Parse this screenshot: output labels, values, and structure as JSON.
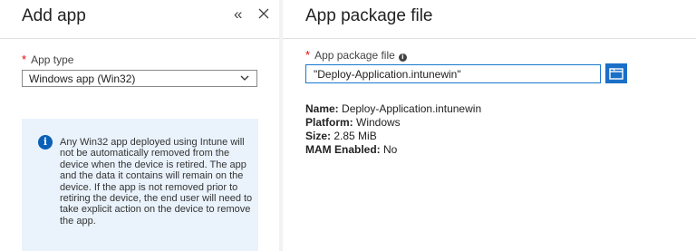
{
  "left_blade": {
    "title": "Add app",
    "app_type_label": "App type",
    "app_type_required": "*",
    "app_type_value": "Windows app (Win32)",
    "info_text": "Any Win32 app deployed using Intune will not be automatically removed from the device when the device is retired. The app and the data it contains will remain on the device. If the app is not removed prior to retiring the device, the end user will need to take explicit action on the device to remove the app."
  },
  "right_blade": {
    "title": "App package file",
    "file_label": "App package file",
    "file_required": "*",
    "file_value": "\"Deploy-Application.intunewin\"",
    "details": {
      "name_label": "Name:",
      "name_value": " Deploy-Application.intunewin",
      "platform_label": "Platform:",
      "platform_value": " Windows",
      "size_label": "Size:",
      "size_value": " 2.85 MiB",
      "mam_label": "MAM Enabled:",
      "mam_value": " No"
    }
  },
  "icons": {
    "collapse": "«",
    "close": "✕",
    "info": "i",
    "browse": "folder-icon"
  },
  "colors": {
    "accent": "#1a6fc7",
    "info_bg": "#eaf3fc",
    "required": "#e00000"
  }
}
